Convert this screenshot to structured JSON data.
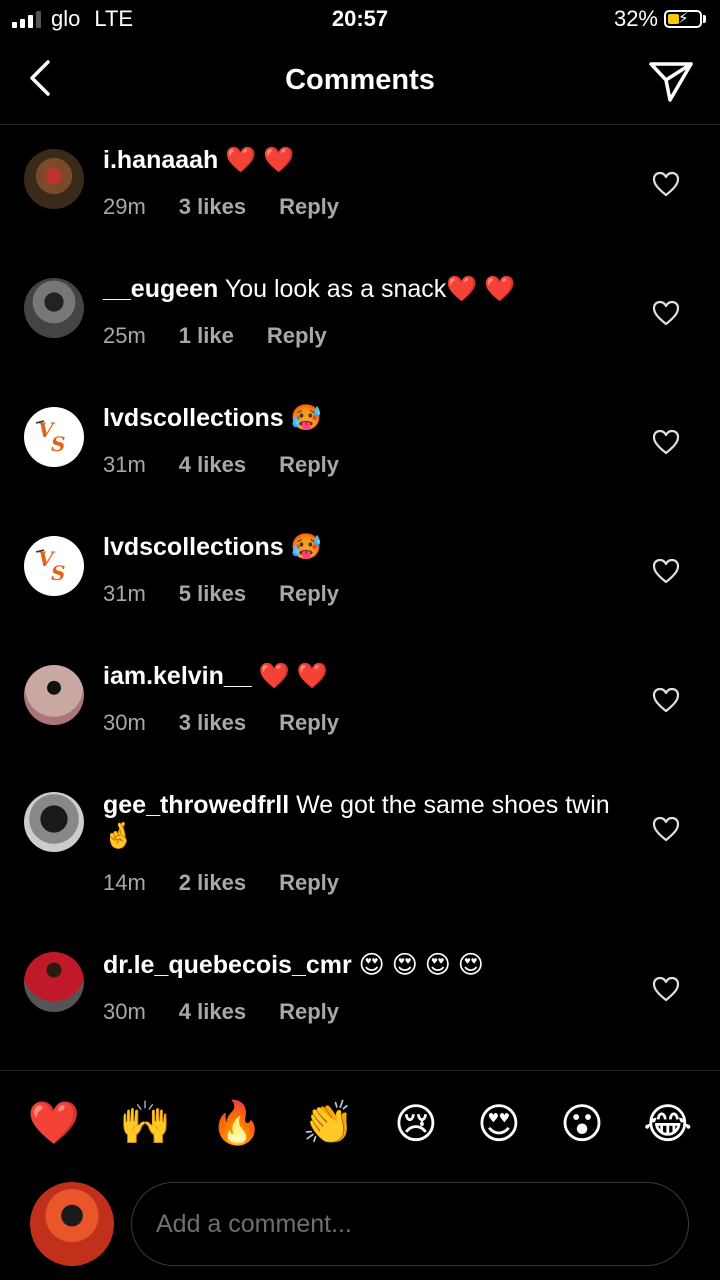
{
  "status": {
    "carrier": "glo",
    "network": "LTE",
    "time": "20:57",
    "battery": "32%"
  },
  "header": {
    "title": "Comments",
    "back_icon": "chevron-left-icon",
    "send_icon": "paper-plane-icon"
  },
  "comments": [
    {
      "user": "i.hanaaah",
      "text": " ❤️ ❤️",
      "time": "29m",
      "likes": "3 likes",
      "reply": "Reply"
    },
    {
      "user": "__eugeen",
      "text": " You look as a snack❤️ ❤️",
      "time": "25m",
      "likes": "1 like",
      "reply": "Reply"
    },
    {
      "user": "lvdscollections",
      "text": " 🥵",
      "time": "31m",
      "likes": "4 likes",
      "reply": "Reply"
    },
    {
      "user": "lvdscollections",
      "text": " 🥵",
      "time": "31m",
      "likes": "5 likes",
      "reply": "Reply"
    },
    {
      "user": "iam.kelvin__",
      "text": " ❤️ ❤️",
      "time": "30m",
      "likes": "3 likes",
      "reply": "Reply"
    },
    {
      "user": "gee_throwedfrll",
      "text": " We got the same shoes twin 🤞",
      "time": "14m",
      "likes": "2 likes",
      "reply": "Reply"
    },
    {
      "user": "dr.le_quebecois_cmr",
      "text": " 😍 😍 😍 😍",
      "time": "30m",
      "likes": "4 likes",
      "reply": "Reply"
    }
  ],
  "quick_reactions": [
    "❤️",
    "🙌",
    "🔥",
    "👏",
    "😢",
    "😍",
    "😮",
    "😂"
  ],
  "composer": {
    "placeholder": "Add a comment..."
  },
  "colors": {
    "background": "#000000",
    "meta_text": "#a8a8a8",
    "divider": "#262626",
    "battery_fill": "#f6c90e"
  }
}
